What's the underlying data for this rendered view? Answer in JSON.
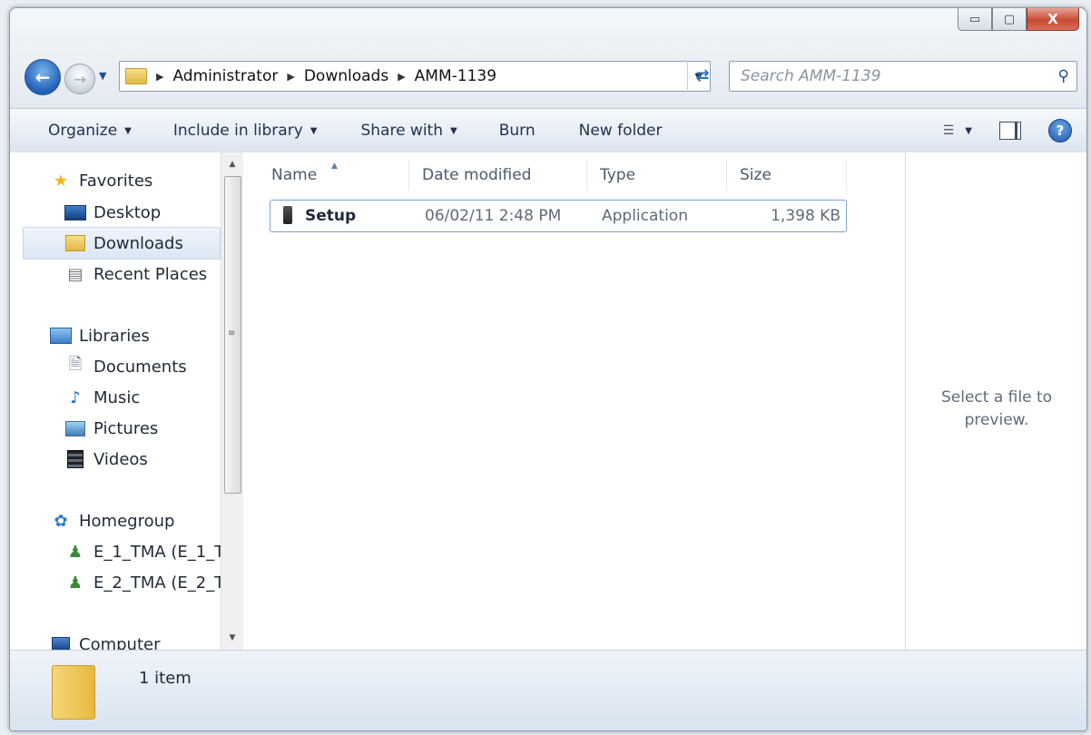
{
  "window": {
    "caption_buttons": {
      "minimize": "▭",
      "maximize": "▢",
      "close": "X"
    }
  },
  "nav": {
    "breadcrumbs": [
      "Administrator",
      "Downloads",
      "AMM-1139"
    ],
    "search_placeholder": "Search AMM-1139"
  },
  "toolbar": {
    "items": [
      "Organize",
      "Include in library",
      "Share with",
      "Burn",
      "New folder"
    ]
  },
  "sidebar": {
    "favorites": {
      "label": "Favorites",
      "items": [
        "Desktop",
        "Downloads",
        "Recent Places"
      ]
    },
    "libraries": {
      "label": "Libraries",
      "items": [
        "Documents",
        "Music",
        "Pictures",
        "Videos"
      ]
    },
    "homegroup": {
      "label": "Homegroup",
      "items": [
        "E_1_TMA (E_1_T",
        "E_2_TMA (E_2_T"
      ]
    },
    "computer": {
      "label": "Computer"
    },
    "selected": "Downloads"
  },
  "columns": [
    "Name",
    "Date modified",
    "Type",
    "Size"
  ],
  "files": [
    {
      "name": "Setup",
      "date_modified": "06/02/11 2:48 PM",
      "type": "Application",
      "size": "1,398 KB"
    }
  ],
  "preview": {
    "line1": "Select a file to",
    "line2": "preview."
  },
  "status": {
    "count": "1 item"
  }
}
